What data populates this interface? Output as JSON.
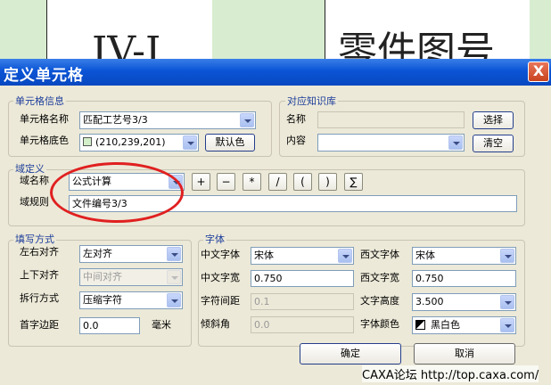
{
  "background": {
    "left_text": "IV-I",
    "right_text": "零件图号"
  },
  "window": {
    "title": "定义单元格",
    "close_glyph": "X"
  },
  "cell_info": {
    "group_label": "单元格信息",
    "name_label": "单元格名称",
    "name_value": "匹配工艺号3/3",
    "color_label": "单元格底色",
    "color_value": "(210,239,201)",
    "default_color_button": "默认色"
  },
  "knowledge": {
    "group_label": "对应知识库",
    "name_label": "名称",
    "name_value": "",
    "select_button": "选择",
    "content_label": "内容",
    "content_value": "",
    "clear_button": "清空"
  },
  "domain": {
    "group_label": "域定义",
    "name_label": "域名称",
    "name_value": "公式计算",
    "rule_label": "域规则",
    "rule_value": "文件编号3/3",
    "operators": [
      "+",
      "−",
      "*",
      "/",
      "(",
      ")",
      "∑"
    ]
  },
  "fill": {
    "group_label": "填写方式",
    "halign_label": "左右对齐",
    "halign_value": "左对齐",
    "valign_label": "上下对齐",
    "valign_value": "中间对齐",
    "wrap_label": "拆行方式",
    "wrap_value": "压缩字符",
    "margin_label": "首字边距",
    "margin_value": "0.0",
    "margin_unit": "毫米"
  },
  "font": {
    "group_label": "字体",
    "cn_font_label": "中文字体",
    "cn_font_value": "宋体",
    "west_font_label": "西文字体",
    "west_font_value": "宋体",
    "cn_width_label": "中文字宽",
    "cn_width_value": "0.750",
    "west_width_label": "西文字宽",
    "west_width_value": "0.750",
    "spacing_label": "字符间距",
    "spacing_value": "0.1",
    "height_label": "文字高度",
    "height_value": "3.500",
    "slant_label": "倾斜角",
    "slant_value": "0.0",
    "color_label": "字体颜色",
    "color_value": "黑白色"
  },
  "buttons": {
    "ok": "确定",
    "cancel": "取消"
  },
  "watermark": "CAXA论坛 http://top.caxa.com/",
  "colors": {
    "title_bar": "#0a54d6",
    "dialog_bg": "#ece9d8",
    "group_label": "#1c3d9a",
    "highlight": "#e02020",
    "cell_fill": "#d2efc9"
  }
}
